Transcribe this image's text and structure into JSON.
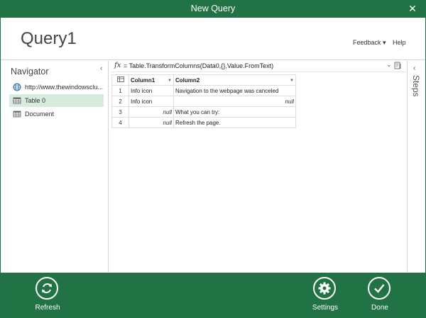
{
  "window": {
    "title": "New Query"
  },
  "header": {
    "query_name": "Query1",
    "feedback_label": "Feedback ▾",
    "help_label": "Help"
  },
  "navigator": {
    "title": "Navigator",
    "items": [
      {
        "label": "http://www.thewindowsclu...",
        "icon": "globe-icon"
      },
      {
        "label": "Table 0",
        "icon": "table-icon",
        "selected": true
      },
      {
        "label": "Document",
        "icon": "table-icon"
      }
    ]
  },
  "formula": {
    "fx": "fx",
    "text": "= Table.TransformColumns(Data0,{},Value.FromText)"
  },
  "table": {
    "columns": [
      "Column1",
      "Column2"
    ],
    "rows": [
      {
        "num": "1",
        "c1": "Info icon",
        "c2": "Navigation to the webpage was canceled"
      },
      {
        "num": "2",
        "c1": "Info icon",
        "c2": "null"
      },
      {
        "num": "3",
        "c1": "null",
        "c2": "What you can try:"
      },
      {
        "num": "4",
        "c1": "null",
        "c2": "Refresh the page."
      }
    ]
  },
  "steps": {
    "label": "Steps"
  },
  "bottom": {
    "refresh_label": "Refresh",
    "settings_label": "Settings",
    "done_label": "Done"
  },
  "colors": {
    "accent": "#217346",
    "selected_row": "#d7ebdf"
  }
}
